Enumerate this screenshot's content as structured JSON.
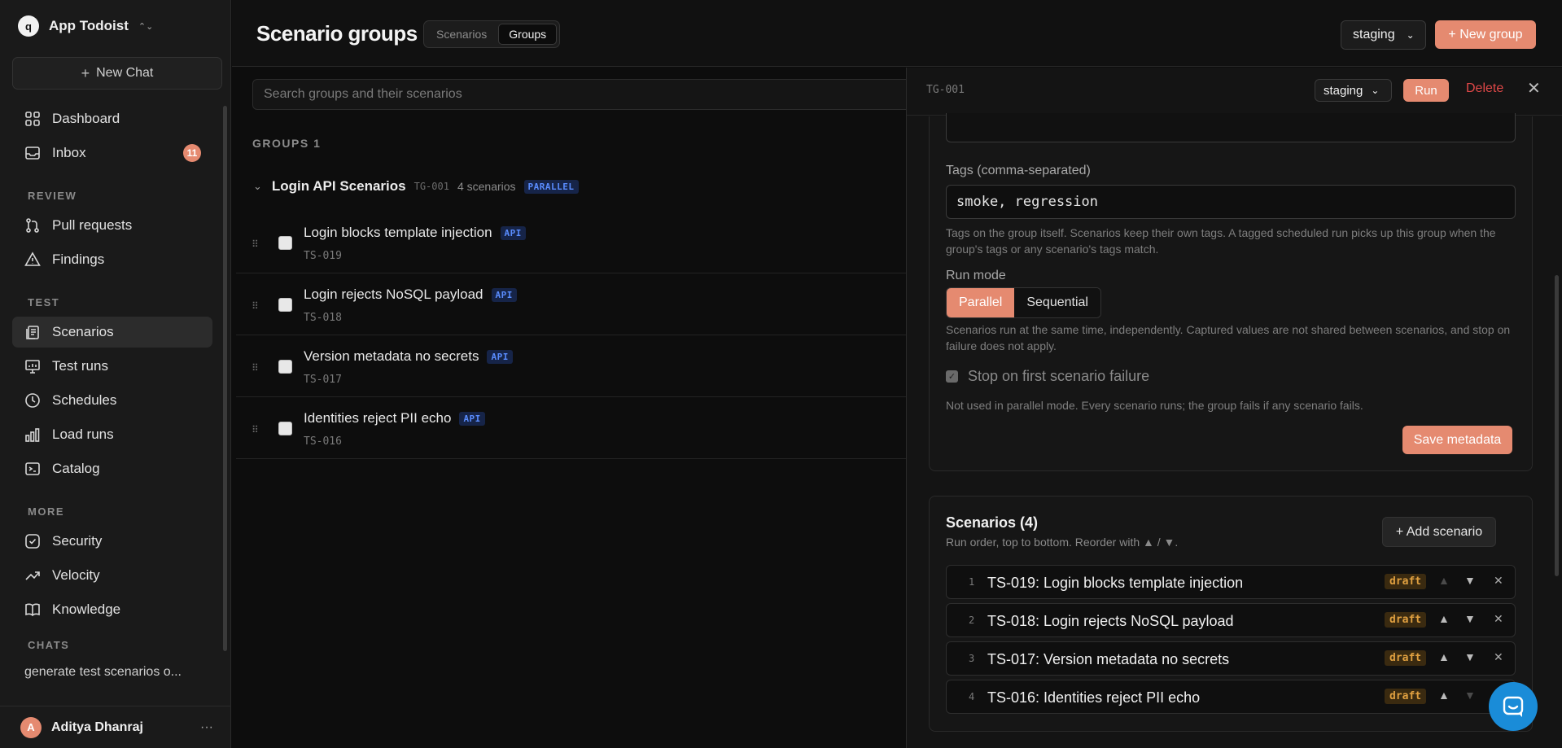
{
  "workspace": {
    "name": "App Todoist",
    "logo_letter": "q"
  },
  "sidebar": {
    "new_chat": "New Chat",
    "items": {
      "dashboard": "Dashboard",
      "inbox": "Inbox",
      "inbox_badge": "11",
      "pull_requests": "Pull requests",
      "findings": "Findings",
      "scenarios": "Scenarios",
      "test_runs": "Test runs",
      "schedules": "Schedules",
      "load_runs": "Load runs",
      "catalog": "Catalog",
      "security": "Security",
      "velocity": "Velocity",
      "knowledge": "Knowledge"
    },
    "sections": {
      "review": "REVIEW",
      "test": "TEST",
      "more": "MORE",
      "chats": "CHATS"
    },
    "chat_item": "generate test scenarios o...",
    "user": {
      "name": "Aditya Dhanraj",
      "initial": "A"
    }
  },
  "header": {
    "title": "Scenario groups",
    "tabs": [
      "Scenarios",
      "Groups"
    ],
    "env": "staging",
    "new_group": "+ New group"
  },
  "list": {
    "search_placeholder": "Search groups and their scenarios",
    "groups_count": "GROUPS 1",
    "group": {
      "name": "Login API Scenarios",
      "id": "TG-001",
      "count": "4 scenarios",
      "mode_tag": "PARALLEL"
    },
    "rows": [
      {
        "title": "Login blocks template injection",
        "tag": "API",
        "id": "TS-019"
      },
      {
        "title": "Login rejects NoSQL payload",
        "tag": "API",
        "id": "TS-018"
      },
      {
        "title": "Version metadata no secrets",
        "tag": "API",
        "id": "TS-017"
      },
      {
        "title": "Identities reject PII echo",
        "tag": "API",
        "id": "TS-016"
      }
    ]
  },
  "panel": {
    "id": "TG-001",
    "env": "staging",
    "run": "Run",
    "delete": "Delete",
    "tags_label": "Tags (comma-separated)",
    "tags_value": "smoke, regression",
    "tags_help": "Tags on the group itself. Scenarios keep their own tags. A tagged scheduled run picks up this group when the group's tags or any scenario's tags match.",
    "run_mode_label": "Run mode",
    "run_modes": [
      "Parallel",
      "Sequential"
    ],
    "run_mode_help": "Scenarios run at the same time, independently. Captured values are not shared between scenarios, and stop on failure does not apply.",
    "stop_label": "Stop on first scenario failure",
    "stop_help": "Not used in parallel mode. Every scenario runs; the group fails if any scenario fails.",
    "save": "Save metadata",
    "scenarios_title": "Scenarios (4)",
    "scenarios_sub": "Run order, top to bottom. Reorder with ▲ / ▼.",
    "add_scenario": "+ Add scenario",
    "scenarios": [
      {
        "num": "1",
        "name": "TS-019: Login blocks template injection",
        "status": "draft"
      },
      {
        "num": "2",
        "name": "TS-018: Login rejects NoSQL payload",
        "status": "draft"
      },
      {
        "num": "3",
        "name": "TS-017: Version metadata no secrets",
        "status": "draft"
      },
      {
        "num": "4",
        "name": "TS-016: Identities reject PII echo",
        "status": "draft"
      }
    ]
  },
  "colors": {
    "accent": "#e58a70",
    "danger": "#e04848",
    "info": "#5a8dff",
    "warning": "#e0a040"
  }
}
